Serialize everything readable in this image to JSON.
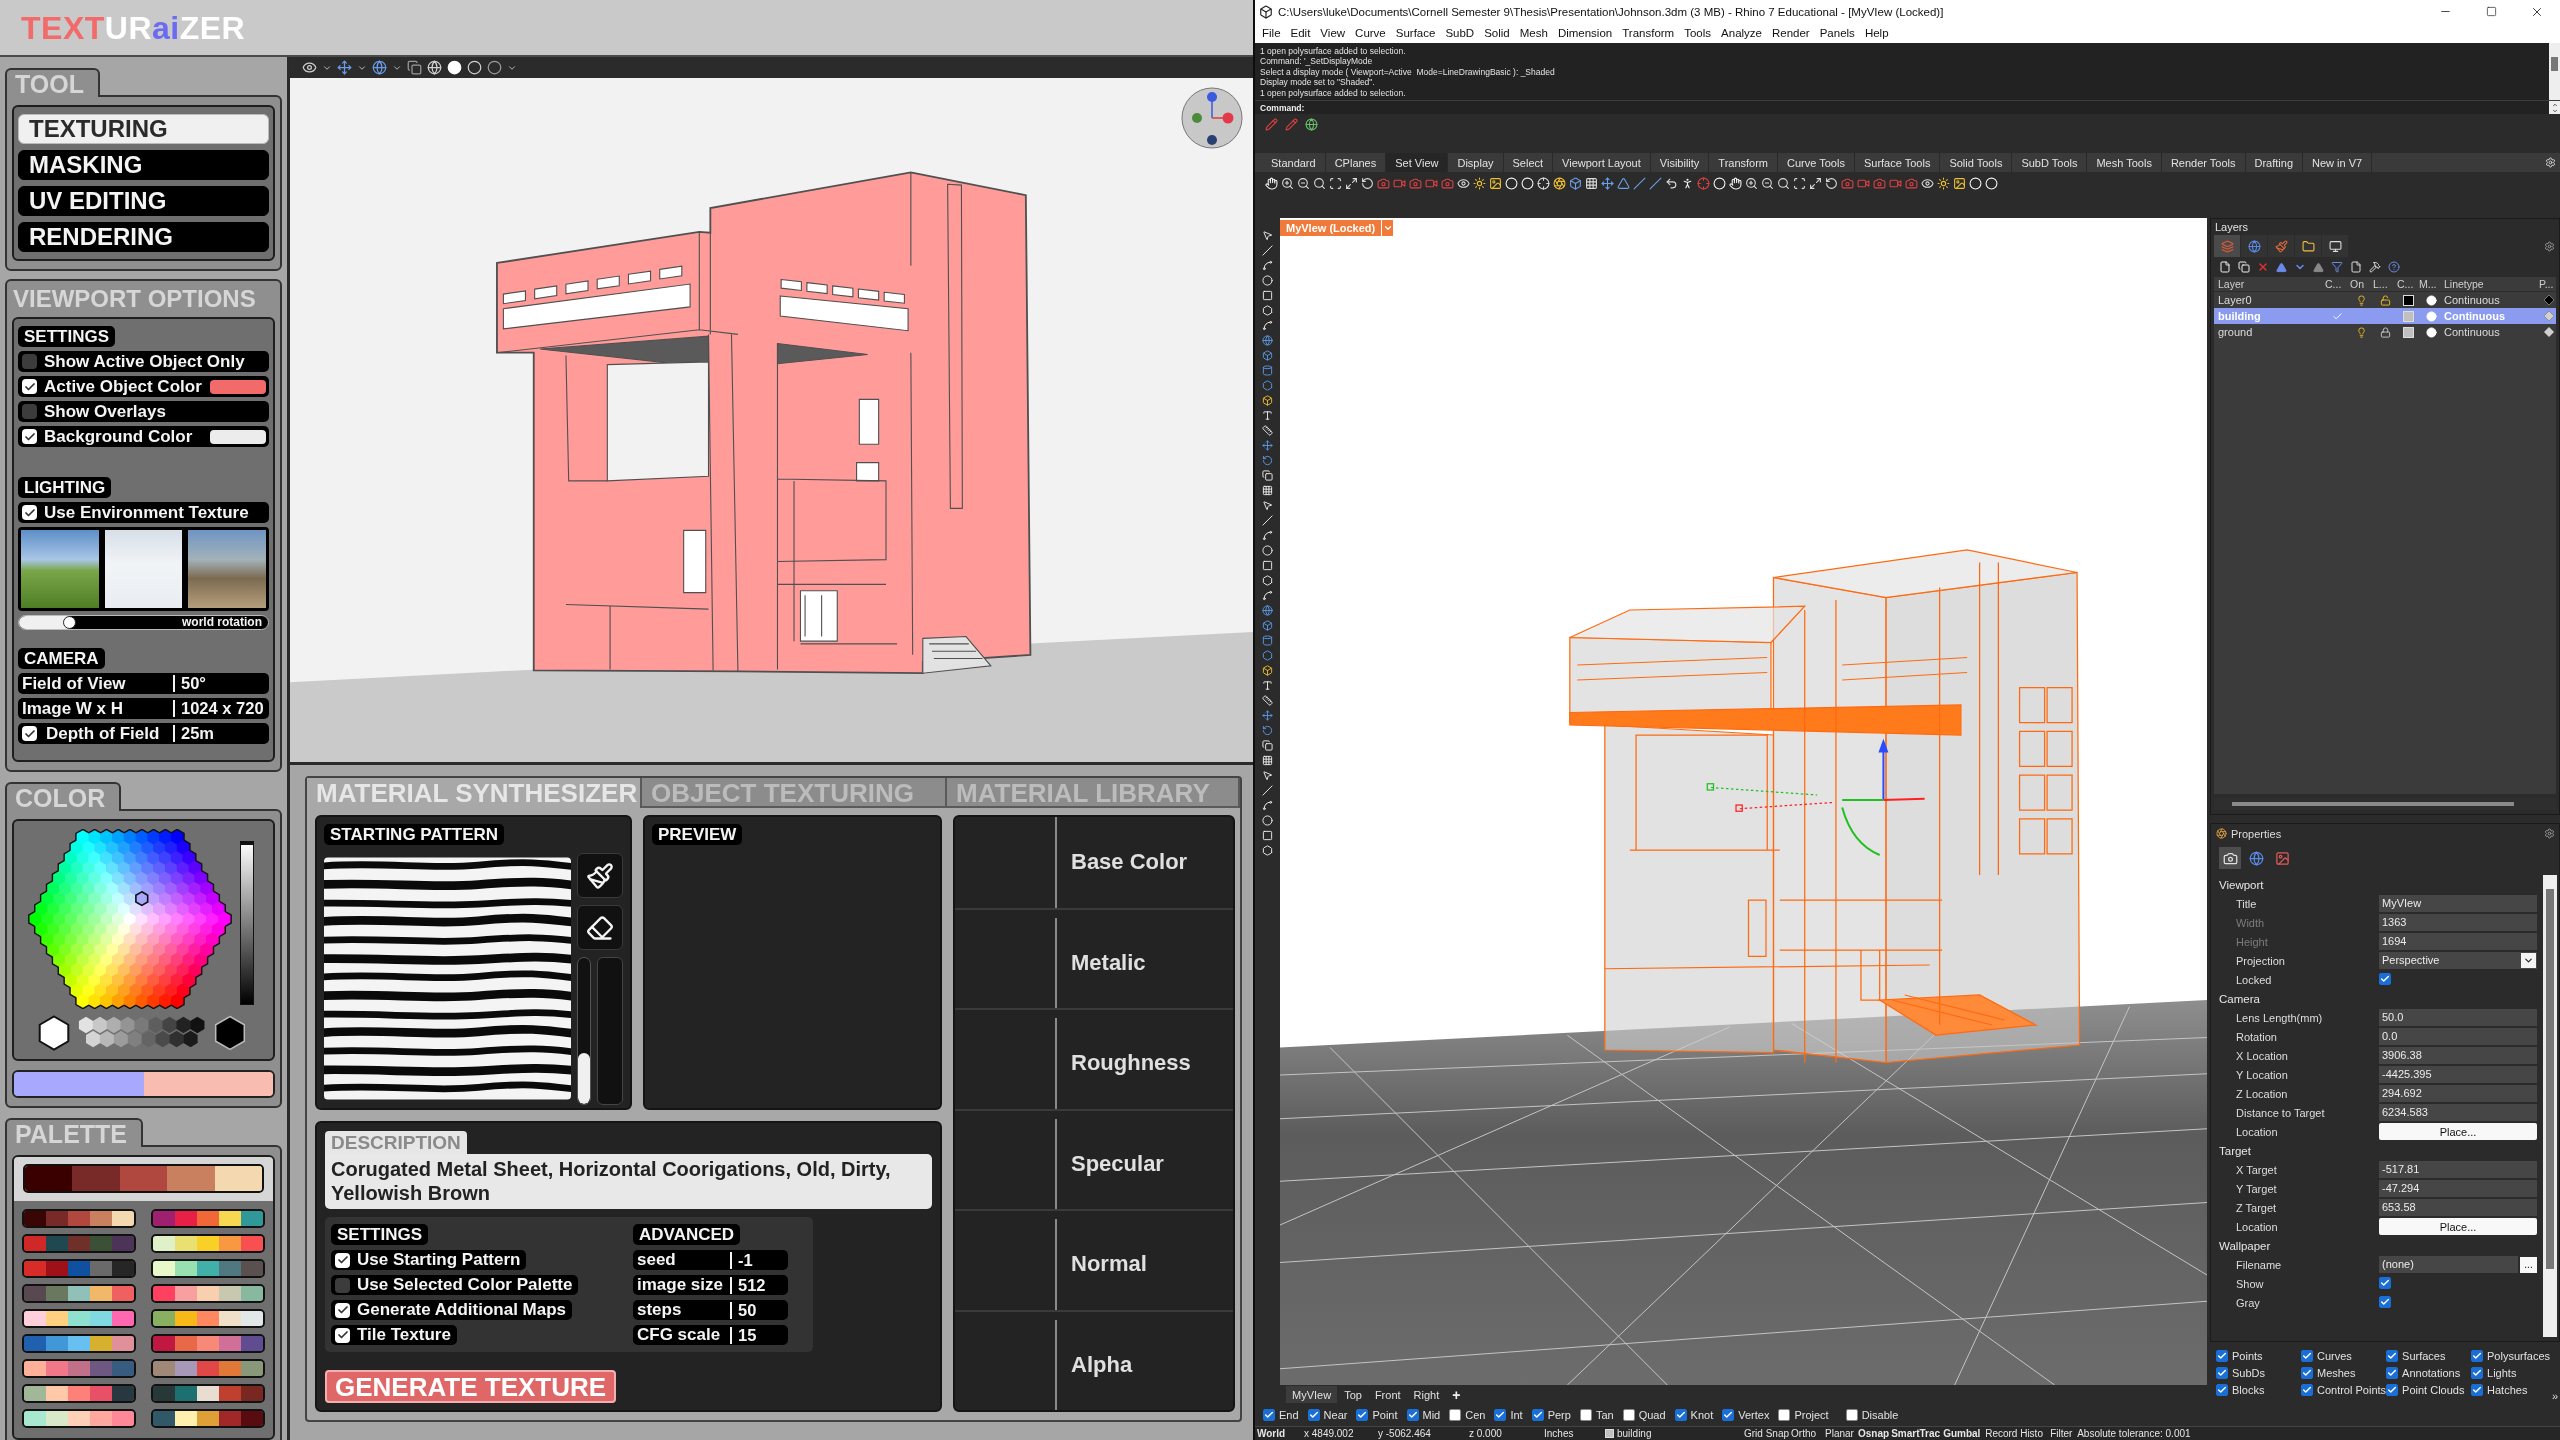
{
  "texturaizer": {
    "logo": [
      {
        "text": "TEXT",
        "color": "#f26a6a"
      },
      {
        "text": "UR",
        "color": "#ffffff"
      },
      {
        "text": "ai",
        "color": "#6a6af2"
      },
      {
        "text": "ZER",
        "color": "#ffffff"
      }
    ],
    "tool": {
      "title": "TOOL",
      "items": [
        {
          "label": "TEXTURING",
          "selected": true
        },
        {
          "label": "MASKING",
          "selected": false
        },
        {
          "label": "UV EDITING",
          "selected": false
        },
        {
          "label": "RENDERING",
          "selected": false
        }
      ]
    },
    "viewport_options": {
      "title": "VIEWPORT OPTIONS",
      "settings": {
        "title": "SETTINGS",
        "items": [
          {
            "label": "Show Active Object Only",
            "checked": false
          },
          {
            "label": "Active Object Color",
            "checked": true,
            "color": "#f26a6a"
          },
          {
            "label": "Show Overlays",
            "checked": false
          },
          {
            "label": "Background Color",
            "checked": true,
            "color": "#ececec"
          }
        ]
      },
      "lighting": {
        "title": "LIGHTING",
        "use_environment": {
          "label": "Use Environment Texture",
          "checked": true
        },
        "rotation": {
          "label": "world rotation",
          "level": 0.2
        }
      },
      "camera": {
        "title": "CAMERA",
        "fields": [
          {
            "label": "Field of View",
            "value": "50°"
          },
          {
            "label": "Image W x H",
            "value": "1024 x 720"
          }
        ],
        "depth_of_field": {
          "label": "Depth of Field",
          "value": "25m",
          "checked": true
        }
      }
    },
    "color": {
      "title": "COLOR",
      "brightness": {
        "level": 1
      },
      "current": {
        "color": "#a8a8ff"
      },
      "previous": {
        "color": "#f8bcb0"
      }
    },
    "palette": {
      "title": "PALETTE",
      "active": [
        {
          "color": "#3a0000"
        },
        {
          "color": "#782a28"
        },
        {
          "color": "#b04840"
        },
        {
          "color": "#c8805e"
        },
        {
          "color": "#f4d8b0"
        }
      ],
      "palettes": [
        {
          "colors": [
            {
              "color": "#3a0505"
            },
            {
              "color": "#782a28"
            },
            {
              "color": "#b04840"
            },
            {
              "color": "#c8805e"
            },
            {
              "color": "#f4d8b0"
            }
          ]
        },
        {
          "colors": [
            {
              "color": "#a02070"
            },
            {
              "color": "#e82048"
            },
            {
              "color": "#f06838"
            },
            {
              "color": "#f8d850"
            },
            {
              "color": "#309898"
            }
          ]
        },
        {
          "colors": [
            {
              "color": "#d02828"
            },
            {
              "color": "#204850"
            },
            {
              "color": "#6e3028"
            },
            {
              "color": "#3c5038"
            },
            {
              "color": "#4c3458"
            }
          ]
        },
        {
          "colors": [
            {
              "color": "#e0f0c8"
            },
            {
              "color": "#e8e070"
            },
            {
              "color": "#f8d028"
            },
            {
              "color": "#f89840"
            },
            {
              "color": "#f85050"
            }
          ]
        },
        {
          "colors": [
            {
              "color": "#d82c28"
            },
            {
              "color": "#a01018"
            },
            {
              "color": "#1050a0"
            },
            {
              "color": "#6a6a6a"
            },
            {
              "color": "#262626"
            }
          ]
        },
        {
          "colors": [
            {
              "color": "#e8f8c8"
            },
            {
              "color": "#98e0b0"
            },
            {
              "color": "#40b0a8"
            },
            {
              "color": "#507880"
            },
            {
              "color": "#5a5050"
            }
          ]
        },
        {
          "colors": [
            {
              "color": "#584850"
            },
            {
              "color": "#6a7860"
            },
            {
              "color": "#90c0b8"
            },
            {
              "color": "#f0b868"
            },
            {
              "color": "#f06060"
            }
          ]
        },
        {
          "colors": [
            {
              "color": "#ff4060"
            },
            {
              "color": "#f8a0a0"
            },
            {
              "color": "#f8d0b0"
            },
            {
              "color": "#c8c8b0"
            },
            {
              "color": "#88b8a0"
            }
          ]
        },
        {
          "colors": [
            {
              "color": "#ffd0dc"
            },
            {
              "color": "#ffd080"
            },
            {
              "color": "#90e0d0"
            },
            {
              "color": "#80d8e0"
            },
            {
              "color": "#ff68b0"
            }
          ]
        },
        {
          "colors": [
            {
              "color": "#88b060"
            },
            {
              "color": "#f8b818"
            },
            {
              "color": "#ff8860"
            },
            {
              "color": "#f0e0c8"
            },
            {
              "color": "#e0e8e8"
            }
          ]
        },
        {
          "colors": [
            {
              "color": "#2060b0"
            },
            {
              "color": "#4098d8"
            },
            {
              "color": "#68c0f0"
            },
            {
              "color": "#d8b030"
            },
            {
              "color": "#e09098"
            }
          ]
        },
        {
          "colors": [
            {
              "color": "#c01840"
            },
            {
              "color": "#e86848"
            },
            {
              "color": "#f88878"
            },
            {
              "color": "#d07098"
            },
            {
              "color": "#604c90"
            }
          ]
        },
        {
          "colors": [
            {
              "color": "#ffb098"
            },
            {
              "color": "#f07888"
            },
            {
              "color": "#c07088"
            },
            {
              "color": "#6c5880"
            },
            {
              "color": "#385c80"
            }
          ]
        },
        {
          "colors": [
            {
              "color": "#a08878"
            },
            {
              "color": "#a898b8"
            },
            {
              "color": "#e04848"
            },
            {
              "color": "#e07838"
            },
            {
              "color": "#889878"
            }
          ]
        },
        {
          "colors": [
            {
              "color": "#a0b898"
            },
            {
              "color": "#ffc8a8"
            },
            {
              "color": "#ff8078"
            },
            {
              "color": "#e85068"
            },
            {
              "color": "#283840"
            }
          ]
        },
        {
          "colors": [
            {
              "color": "#283838"
            },
            {
              "color": "#1c7070"
            },
            {
              "color": "#e8ddd0"
            },
            {
              "color": "#c04030"
            },
            {
              "color": "#782820"
            }
          ]
        },
        {
          "colors": [
            {
              "color": "#a8e8d0"
            },
            {
              "color": "#d8e8c8"
            },
            {
              "color": "#ffd0b8"
            },
            {
              "color": "#ffa8a0"
            },
            {
              "color": "#ff8898"
            }
          ]
        },
        {
          "colors": [
            {
              "color": "#305868"
            },
            {
              "color": "#fff0b0"
            },
            {
              "color": "#e0a038"
            },
            {
              "color": "#a02828"
            },
            {
              "color": "#580c10"
            }
          ]
        }
      ]
    },
    "panel": {
      "tabs": [
        {
          "label": "MATERIAL SYNTHESIZER",
          "selected": true
        },
        {
          "label": "OBJECT TEXTURING",
          "selected": false
        },
        {
          "label": "MATERIAL LIBRARY",
          "selected": false
        }
      ],
      "starting_pattern": {
        "title": "STARTING PATTERN",
        "brush_size": {
          "level": 0.35
        }
      },
      "preview": {
        "title": "PREVIEW"
      },
      "description": {
        "title": "DESCRIPTION",
        "value": "Corugated Metal Sheet, Horizontal Coorigations, Old, Dirty, Yellowish Brown"
      },
      "settings": {
        "title": "SETTINGS",
        "items": [
          {
            "label": "Use Starting Pattern",
            "checked": true
          },
          {
            "label": "Use Selected Color Palette",
            "checked": false
          },
          {
            "label": "Generate Additional Maps",
            "checked": true
          },
          {
            "label": "Tile Texture",
            "checked": true
          }
        ]
      },
      "advanced": {
        "title": "ADVANCED",
        "fields": [
          {
            "label": "seed",
            "value": "-1"
          },
          {
            "label": "image size",
            "value": "512"
          },
          {
            "label": "steps",
            "value": "50"
          },
          {
            "label": "CFG scale",
            "value": "15"
          }
        ]
      },
      "generate_button": "GENERATE TEXTURE",
      "maps": [
        {
          "label": "Base Color"
        },
        {
          "label": "Metalic"
        },
        {
          "label": "Roughness"
        },
        {
          "label": "Specular"
        },
        {
          "label": "Normal"
        },
        {
          "label": "Alpha"
        }
      ]
    }
  },
  "rhino": {
    "title": "C:\\Users\\luke\\Documents\\Cornell Semester 9\\Thesis\\Presentation\\Johnson.3dm (3 MB) - Rhino 7 Educational - [MyVIew (Locked)]",
    "menu": [
      "File",
      "Edit",
      "View",
      "Curve",
      "Surface",
      "SubD",
      "Solid",
      "Mesh",
      "Dimension",
      "Transform",
      "Tools",
      "Analyze",
      "Render",
      "Panels",
      "Help"
    ],
    "command_history": [
      "1 open polysurface added to selection.",
      "Command: '_SetDisplayMode",
      "Select a display mode ( Viewport=Active  Mode=LineDrawingBasic ): _Shaded",
      "Display mode set to \"Shaded\".",
      "1 open polysurface added to selection."
    ],
    "command_prompt": "Command:",
    "toolbar_tabs": [
      {
        "label": "Standard",
        "selected": false
      },
      {
        "label": "CPlanes",
        "selected": false
      },
      {
        "label": "Set View",
        "selected": true
      },
      {
        "label": "Display",
        "selected": false
      },
      {
        "label": "Select",
        "selected": false
      },
      {
        "label": "Viewport Layout",
        "selected": false
      },
      {
        "label": "Visibility",
        "selected": false
      },
      {
        "label": "Transform",
        "selected": false
      },
      {
        "label": "Curve Tools",
        "selected": false
      },
      {
        "label": "Surface Tools",
        "selected": false
      },
      {
        "label": "Solid Tools",
        "selected": false
      },
      {
        "label": "SubD Tools",
        "selected": false
      },
      {
        "label": "Mesh Tools",
        "selected": false
      },
      {
        "label": "Render Tools",
        "selected": false
      },
      {
        "label": "Drafting",
        "selected": false
      },
      {
        "label": "New in V7",
        "selected": false
      }
    ],
    "viewport_label": "MyVIew (Locked)",
    "layers": {
      "title": "Layers",
      "tabs": [
        {
          "selected": true
        },
        {
          "selected": false
        },
        {
          "selected": false
        },
        {
          "selected": false
        },
        {
          "selected": false
        }
      ],
      "columns": [
        "Layer",
        "C...",
        "On",
        "L...",
        "C...",
        "M...",
        "Linetype",
        "P..."
      ],
      "rows": [
        {
          "name": "Layer0",
          "kind": "layer",
          "selected": false,
          "on": true,
          "locked": false,
          "color": "#000000",
          "print": {
            "color": "#000000"
          },
          "linetype": "Continuous"
        },
        {
          "name": "building",
          "kind": "current",
          "selected": true,
          "color": "#c0c0c0",
          "print": {
            "color": "#d0d0d0"
          },
          "linetype": "Continuous"
        },
        {
          "name": "ground",
          "kind": "layer",
          "selected": false,
          "on": true,
          "locked": true,
          "color": "#c0c0c0",
          "print": {
            "color": "#d0d0d0"
          },
          "linetype": "Continuous"
        }
      ]
    },
    "properties": {
      "title": "Properties",
      "tabs": [
        {
          "selected": true
        },
        {
          "selected": false
        },
        {
          "selected": false
        }
      ],
      "sections": [
        {
          "title": "Viewport",
          "rows": [
            {
              "label": "Title",
              "kind": "text",
              "value": "MyVIew",
              "disabled": false
            },
            {
              "label": "Width",
              "kind": "text",
              "value": "1363",
              "disabled": true
            },
            {
              "label": "Height",
              "kind": "text",
              "value": "1694",
              "disabled": true
            },
            {
              "label": "Projection",
              "kind": "select",
              "value": "Perspective",
              "disabled": false
            },
            {
              "label": "Locked",
              "kind": "check",
              "checked": true,
              "disabled": false
            }
          ]
        },
        {
          "title": "Camera",
          "rows": [
            {
              "label": "Lens Length(mm)",
              "kind": "text",
              "value": "50.0",
              "disabled": false
            },
            {
              "label": "Rotation",
              "kind": "text",
              "value": "0.0",
              "disabled": false
            },
            {
              "label": "X Location",
              "kind": "text",
              "value": "3906.38",
              "disabled": false
            },
            {
              "label": "Y Location",
              "kind": "text",
              "value": "-4425.395",
              "disabled": false
            },
            {
              "label": "Z Location",
              "kind": "text",
              "value": "294.692",
              "disabled": false
            },
            {
              "label": "Distance to Target",
              "kind": "text",
              "value": "6234.583",
              "disabled": false
            },
            {
              "label": "Location",
              "kind": "button",
              "value": "Place...",
              "disabled": false
            }
          ]
        },
        {
          "title": "Target",
          "rows": [
            {
              "label": "X Target",
              "kind": "text",
              "value": "-517.81",
              "disabled": false
            },
            {
              "label": "Y Target",
              "kind": "text",
              "value": "-47.294",
              "disabled": false
            },
            {
              "label": "Z Target",
              "kind": "text",
              "value": "653.58",
              "disabled": false
            },
            {
              "label": "Location",
              "kind": "button",
              "value": "Place...",
              "disabled": false
            }
          ]
        },
        {
          "title": "Wallpaper",
          "rows": [
            {
              "label": "Filename",
              "kind": "file",
              "value": "(none)",
              "button": "...",
              "disabled": false
            },
            {
              "label": "Show",
              "kind": "check",
              "checked": true,
              "disabled": false
            },
            {
              "label": "Gray",
              "kind": "check",
              "checked": true,
              "disabled": false
            }
          ]
        }
      ]
    },
    "object_filters": [
      {
        "label": "Points",
        "checked": true
      },
      {
        "label": "Curves",
        "checked": true
      },
      {
        "label": "Surfaces",
        "checked": true
      },
      {
        "label": "Polysurfaces",
        "checked": true
      },
      {
        "label": "SubDs",
        "checked": true
      },
      {
        "label": "Meshes",
        "checked": true
      },
      {
        "label": "Annotations",
        "checked": true
      },
      {
        "label": "Lights",
        "checked": true
      },
      {
        "label": "Blocks",
        "checked": true
      },
      {
        "label": "Control Points",
        "checked": true
      },
      {
        "label": "Point Clouds",
        "checked": true
      },
      {
        "label": "Hatches",
        "checked": true
      }
    ],
    "more_button": "»",
    "viewport_tabs": [
      {
        "label": "MyVIew",
        "selected": true
      },
      {
        "label": "Top",
        "selected": false
      },
      {
        "label": "Front",
        "selected": false
      },
      {
        "label": "Right",
        "selected": false
      }
    ],
    "add_tab": "+",
    "osnaps": [
      {
        "label": "End",
        "checked": true
      },
      {
        "label": "Near",
        "checked": true
      },
      {
        "label": "Point",
        "checked": true
      },
      {
        "label": "Mid",
        "checked": true
      },
      {
        "label": "Cen",
        "checked": false
      },
      {
        "label": "Int",
        "checked": true
      },
      {
        "label": "Perp",
        "checked": true
      },
      {
        "label": "Tan",
        "checked": false
      },
      {
        "label": "Quad",
        "checked": false
      },
      {
        "label": "Knot",
        "checked": true
      },
      {
        "label": "Vertex",
        "checked": true
      },
      {
        "label": "Project",
        "checked": false
      }
    ],
    "osnap_disable": {
      "label": "Disable",
      "checked": false
    },
    "status": {
      "cplane": "World",
      "x": "x 4849.002",
      "y": "y -5062.464",
      "z": "z 0.000",
      "units": "Inches",
      "layer": {
        "name": "building",
        "color": "#c0c0c0"
      },
      "toggles": [
        {
          "label": "Grid Snap",
          "on": false
        },
        {
          "label": "Ortho",
          "on": false
        },
        {
          "label": "Planar",
          "on": false
        },
        {
          "label": "Osnap",
          "on": true
        },
        {
          "label": "SmartTrac",
          "on": true
        },
        {
          "label": "Gumbal",
          "on": true
        },
        {
          "label": "Record Histo",
          "on": false
        },
        {
          "label": "Filter",
          "on": false
        }
      ],
      "tolerance": "Absolute tolerance: 0.001"
    }
  }
}
